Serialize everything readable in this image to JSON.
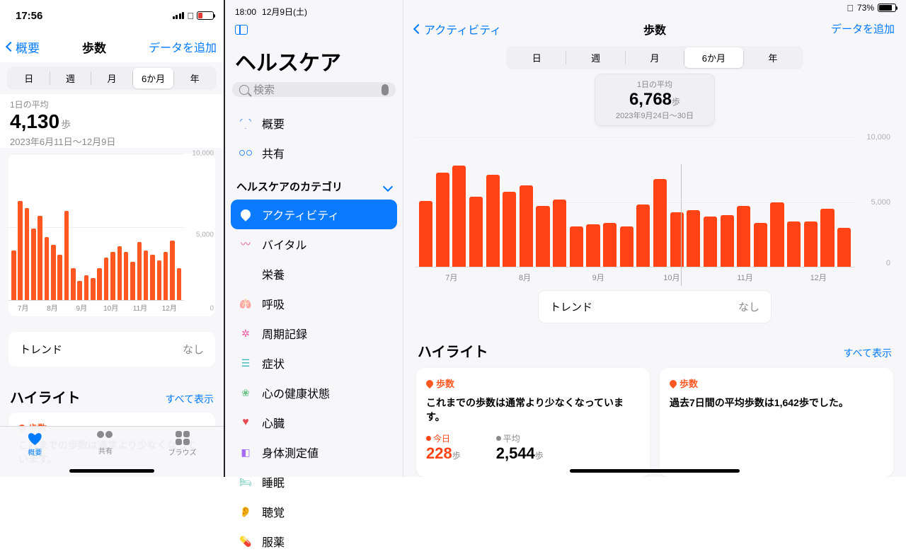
{
  "iphone": {
    "status_time": "17:56",
    "nav": {
      "back": "概要",
      "title": "歩数",
      "action": "データを追加"
    },
    "segments": [
      "日",
      "週",
      "月",
      "6か月",
      "年"
    ],
    "segment_selected": 3,
    "summary": {
      "label": "1日の平均",
      "value": "4,130",
      "unit": "歩",
      "range": "2023年6月11日〜12月9日"
    },
    "trend": {
      "label": "トレンド",
      "value": "なし"
    },
    "highlights": {
      "title": "ハイライト",
      "show_all": "すべて表示",
      "card": {
        "tag": "歩数",
        "text": "これまでの歩数は通常より少なくなっています。"
      }
    },
    "tabs": [
      "概要",
      "共有",
      "ブラウズ"
    ]
  },
  "ipad": {
    "status": {
      "time": "18:00",
      "date": "12月9日(土)",
      "battery_pct": "73%"
    },
    "sidebar": {
      "title": "ヘルスケア",
      "search_placeholder": "検索",
      "top_items": [
        "概要",
        "共有"
      ],
      "section_label": "ヘルスケアのカテゴリ",
      "items": [
        "アクティビティ",
        "バイタル",
        "栄養",
        "呼吸",
        "周期記録",
        "症状",
        "心の健康状態",
        "心臓",
        "身体測定値",
        "睡眠",
        "聴覚",
        "服薬"
      ],
      "active_index": 0
    },
    "main": {
      "back": "アクティビティ",
      "title": "歩数",
      "action": "データを追加",
      "segments": [
        "日",
        "週",
        "月",
        "6か月",
        "年"
      ],
      "segment_selected": 3,
      "marker": {
        "label": "1日の平均",
        "value": "6,768",
        "unit": "歩",
        "range": "2023年9月24日〜30日"
      },
      "trend": {
        "label": "トレンド",
        "value": "なし"
      },
      "highlights": {
        "title": "ハイライト",
        "show_all": "すべて表示",
        "card1": {
          "tag": "歩数",
          "text": "これまでの歩数は通常より少なくなっています。",
          "today_label": "今日",
          "today_value": "228",
          "today_unit": "歩",
          "avg_label": "平均",
          "avg_value": "2,544",
          "avg_unit": "歩"
        },
        "card2": {
          "tag": "歩数",
          "text": "過去7日間の平均歩数は1,642歩でした。"
        }
      }
    }
  },
  "chart_data": [
    {
      "type": "bar",
      "title": "歩数 (iPhone, 6か月)",
      "ylabel": "歩",
      "ylim": [
        0,
        10000
      ],
      "x_ticks": [
        "7月",
        "8月",
        "9月",
        "10月",
        "11月",
        "12月"
      ],
      "y_ticks": [
        0,
        5000,
        10000
      ],
      "values": [
        3400,
        6800,
        6300,
        4900,
        5800,
        4300,
        3800,
        3100,
        6100,
        2200,
        1300,
        1700,
        1500,
        2200,
        2900,
        3300,
        3700,
        3300,
        2600,
        4000,
        3400,
        3100,
        2700,
        3300,
        4100,
        2200
      ]
    },
    {
      "type": "bar",
      "title": "歩数 (iPad, 6か月)",
      "ylabel": "歩",
      "ylim": [
        0,
        10000
      ],
      "x_ticks": [
        "7月",
        "8月",
        "9月",
        "10月",
        "11月",
        "12月"
      ],
      "y_ticks": [
        0,
        5000,
        10000
      ],
      "values": [
        5100,
        7300,
        7800,
        5400,
        7100,
        5800,
        6300,
        4700,
        5200,
        3100,
        3300,
        3400,
        3100,
        4800,
        6800,
        4200,
        4400,
        3900,
        4000,
        4700,
        3400,
        5000,
        3500,
        3500,
        4500,
        3000
      ]
    }
  ]
}
